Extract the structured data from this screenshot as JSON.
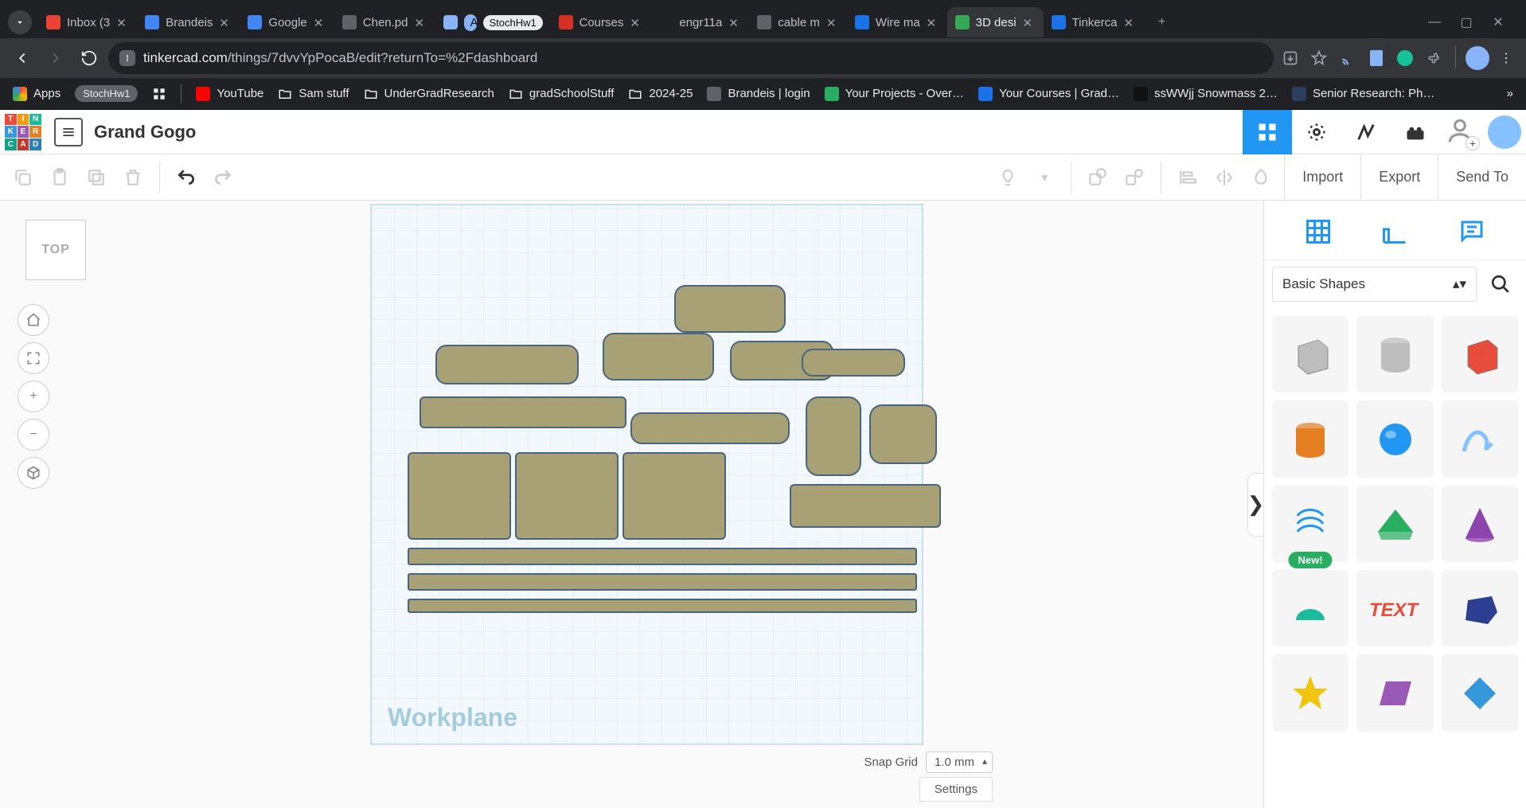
{
  "browser": {
    "tabs": [
      {
        "label": "Inbox (3",
        "favicon_bg": "#ea4335"
      },
      {
        "label": "Brandeis",
        "favicon_bg": "#4285f4"
      },
      {
        "label": "Google ",
        "favicon_bg": "#4285f4"
      },
      {
        "label": "Chen.pd",
        "favicon_bg": "#5f6368"
      },
      {
        "label": "Apps",
        "pill": true,
        "favicon_bg": "#8ab4f8",
        "secondary_pill": "StochHw1"
      },
      {
        "label": "Courses",
        "favicon_bg": "#d93025"
      },
      {
        "label": "engr11a",
        "favicon_bg": ""
      },
      {
        "label": "cable m",
        "favicon_bg": "#5f6368"
      },
      {
        "label": "Wire ma",
        "favicon_bg": "#1a73e8"
      },
      {
        "label": "3D desi",
        "favicon_bg": "#34a853",
        "active": true
      },
      {
        "label": "Tinkerca",
        "favicon_bg": "#1a73e8"
      }
    ],
    "url_domain": "tinkercad.com",
    "url_path": "/things/7dvvYpPocaB/edit?returnTo=%2Fdashboard",
    "bookmarks": [
      {
        "label": "Apps",
        "icon": "apps"
      },
      {
        "label": "StochHw1",
        "pill": true
      },
      {
        "label": "",
        "icon": "grid"
      },
      {
        "label": "YouTube",
        "icon_bg": "#ff0000"
      },
      {
        "label": "Sam stuff",
        "icon": "folder"
      },
      {
        "label": "UnderGradResearch",
        "icon": "folder"
      },
      {
        "label": "gradSchoolStuff",
        "icon": "folder"
      },
      {
        "label": "2024-25",
        "icon": "folder"
      },
      {
        "label": "Brandeis | login",
        "icon_bg": "#5f6368"
      },
      {
        "label": "Your Projects - Over…",
        "icon_bg": "#27ae60"
      },
      {
        "label": "Your Courses | Grad…",
        "icon_bg": "#1a73e8"
      },
      {
        "label": "ssWWjj Snowmass 2…",
        "icon_bg": "#111"
      },
      {
        "label": "Senior Research: Ph…",
        "icon_bg": "#2c3e5f"
      }
    ]
  },
  "app": {
    "logo_letters": [
      "T",
      "I",
      "N",
      "K",
      "E",
      "R",
      "C",
      "A",
      "D"
    ],
    "project_title": "Grand Gogo",
    "toolbar": {
      "import": "Import",
      "export": "Export",
      "send_to": "Send To"
    },
    "view_cube": "TOP",
    "workplane_label": "Workplane",
    "panel": {
      "selector": "Basic Shapes",
      "new_badge": "New!",
      "shapes": [
        {
          "name": "box-hole",
          "color": "#bdbdbd",
          "type": "box"
        },
        {
          "name": "cylinder-hole",
          "color": "#bdbdbd",
          "type": "cylinder"
        },
        {
          "name": "box",
          "color": "#e74c3c",
          "type": "box"
        },
        {
          "name": "cylinder",
          "color": "#e67e22",
          "type": "cylinder"
        },
        {
          "name": "sphere",
          "color": "#2196f3",
          "type": "sphere"
        },
        {
          "name": "scribble",
          "color": "#85c1ff",
          "type": "scribble"
        },
        {
          "name": "torus",
          "color": "#2196f3",
          "type": "custom",
          "new": true
        },
        {
          "name": "roof",
          "color": "#27ae60",
          "type": "roof"
        },
        {
          "name": "cone",
          "color": "#8e44ad",
          "type": "cone"
        },
        {
          "name": "half-cylinder",
          "color": "#1abc9c",
          "type": "half"
        },
        {
          "name": "text",
          "color": "#e74c3c",
          "type": "text"
        },
        {
          "name": "polygon",
          "color": "#2c3e8f",
          "type": "poly"
        },
        {
          "name": "star",
          "color": "#f1c40f",
          "type": "star"
        },
        {
          "name": "para",
          "color": "#9b59b6",
          "type": "para"
        },
        {
          "name": "diamond",
          "color": "#3498db",
          "type": "diamond"
        }
      ]
    },
    "bottom": {
      "settings": "Settings",
      "snap_label": "Snap Grid",
      "snap_value": "1.0 mm"
    }
  }
}
